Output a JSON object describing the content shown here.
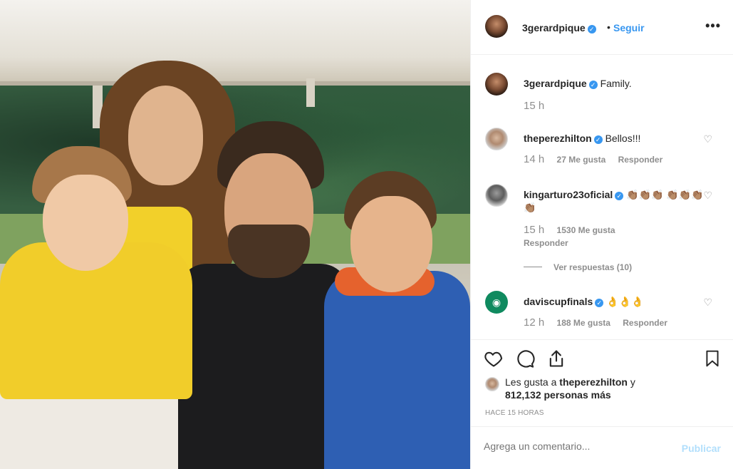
{
  "post": {
    "username": "3gerardpique",
    "verified_mark": "✓",
    "separator": "•",
    "follow_label": "Seguir",
    "more_label": "•••",
    "caption": "Family.",
    "caption_time": "15 h"
  },
  "comments": [
    {
      "user": "theperezhilton",
      "text": "Bellos!!!",
      "time": "14 h",
      "likes": "27 Me gusta",
      "reply": "Responder"
    },
    {
      "user": "kingarturo23oficial",
      "text": "👏🏽👏🏽👏🏽 👏🏽👏🏽👏🏽👏🏽",
      "time": "15 h",
      "likes": "1530 Me gusta",
      "reply": "Responder",
      "view_replies": "Ver respuestas (10)"
    },
    {
      "user": "daviscupfinals",
      "text": "👌👌👌",
      "time": "12 h",
      "likes": "188 Me gusta",
      "reply": "Responder"
    }
  ],
  "likes": {
    "prefix": "Les gusta a",
    "user": "theperezhilton",
    "connector": "y",
    "others": "812,132 personas más"
  },
  "posted_ago": "HACE 15 HORAS",
  "comment_box": {
    "placeholder": "Agrega un comentario...",
    "publish_label": "Publicar"
  },
  "icons": {
    "heart": "heart-icon",
    "comment": "comment-icon",
    "share": "share-icon",
    "save": "bookmark-icon"
  },
  "colors": {
    "link_blue": "#3897f0",
    "publish_disabled": "#b2dffc",
    "secondary_text": "#8e8e8e"
  }
}
